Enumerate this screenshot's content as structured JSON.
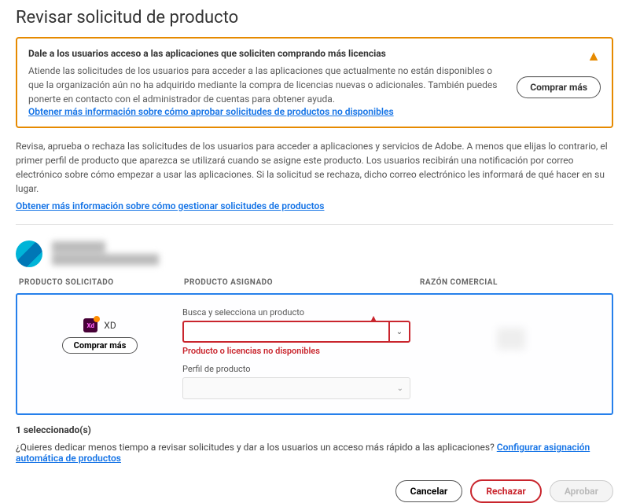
{
  "page": {
    "title": "Revisar solicitud de producto"
  },
  "alert": {
    "title": "Dale a los usuarios acceso a las aplicaciones que soliciten comprando más licencias",
    "body": "Atiende las solicitudes de los usuarios para acceder a las aplicaciones que actualmente no están disponibles o que la organización aún no ha adquirido mediante la compra de licencias nuevas o adicionales. También puedes ponerte en contacto con el administrador de cuentas para obtener ayuda.",
    "learn_link": "Obtener más información sobre cómo aprobar solicitudes de productos no disponibles",
    "buy_label": "Comprar más",
    "warn_glyph": "▲"
  },
  "description": {
    "text": "Revisa, aprueba o rechaza las solicitudes de los usuarios para acceder a aplicaciones y servicios de Adobe. A menos que elijas lo contrario, el primer perfil de producto que aparezca se utilizará cuando se asigne este producto. Los usuarios recibirán una notificación por correo electrónico sobre cómo empezar a usar las aplicaciones. Si la solicitud se rechaza, dicho correo electrónico les informará de qué hacer en su lugar.",
    "learn_link": "Obtener más información sobre cómo gestionar solicitudes de productos"
  },
  "user": {
    "name_placeholder": "████████",
    "email_placeholder": "████████████████"
  },
  "columns": {
    "requested": "PRODUCTO SOLICITADO",
    "assigned": "PRODUCTO ASIGNADO",
    "reason": "RAZÓN COMERCIAL"
  },
  "request": {
    "product_code": "Xd",
    "product_name": "XD",
    "buy_label": "Comprar más",
    "search_label": "Busca y selecciona un producto",
    "search_value": "",
    "dropdown_glyph": "⌄",
    "input_warn_glyph": "▲",
    "error_text": "Producto o licencias no disponibles",
    "profile_label": "Perfil de producto",
    "profile_glyph": "⌄"
  },
  "selection": {
    "count_text": "1 seleccionado(s)"
  },
  "auto": {
    "prompt": "¿Quieres dedicar menos tiempo a revisar solicitudes y dar a los usuarios un acceso más rápido a las aplicaciones? ",
    "link": "Configurar asignación automática de productos"
  },
  "footer": {
    "cancel": "Cancelar",
    "reject": "Rechazar",
    "approve": "Aprobar"
  }
}
